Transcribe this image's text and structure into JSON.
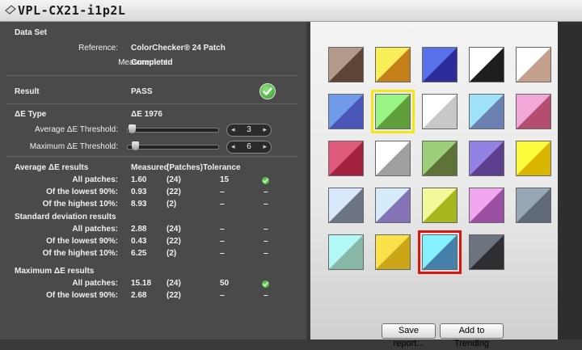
{
  "window": {
    "title": "VPL-CX21-i1p2L"
  },
  "data_set": {
    "heading": "Data Set",
    "reference_label": "Reference:",
    "reference_value": "ColorChecker® 24 Patch",
    "measurement_label": "Measurement:",
    "measurement_value": "Completed"
  },
  "result": {
    "label": "Result",
    "value": "PASS"
  },
  "delta_e": {
    "type_label": "ΔE Type",
    "type_value": "ΔE 1976",
    "average_threshold_label": "Average  ΔE Threshold:",
    "average_threshold_value": "3",
    "average_threshold_fraction": 0.02,
    "maximum_threshold_label": "Maximum ΔE Threshold:",
    "maximum_threshold_value": "6",
    "maximum_threshold_fraction": 0.05
  },
  "avg_results": {
    "heading": "Average ΔE results",
    "col_measured": "Measured",
    "col_patches": "(Patches)",
    "col_tolerance": "Tolerance",
    "rows": [
      {
        "label": "All patches:",
        "measured": "1.60",
        "patches": "(24)",
        "tolerance": "15",
        "status": "check"
      },
      {
        "label": "Of the lowest 90%:",
        "measured": "0.93",
        "patches": "(22)",
        "tolerance": "–",
        "status": "–"
      },
      {
        "label": "Of the highest 10%:",
        "measured": "8.93",
        "patches": "(2)",
        "tolerance": "–",
        "status": "–"
      }
    ]
  },
  "std_results": {
    "heading": "Standard deviation results",
    "rows": [
      {
        "label": "All patches:",
        "measured": "2.88",
        "patches": "(24)",
        "tolerance": "–",
        "status": "–"
      },
      {
        "label": "Of the lowest 90%:",
        "measured": "0.43",
        "patches": "(22)",
        "tolerance": "–",
        "status": "–"
      },
      {
        "label": "Of the highest 10%:",
        "measured": "6.25",
        "patches": "(2)",
        "tolerance": "–",
        "status": "–"
      }
    ]
  },
  "max_results": {
    "heading": "Maximum ΔE results",
    "rows": [
      {
        "label": "All patches:",
        "measured": "15.18",
        "patches": "(24)",
        "tolerance": "50",
        "status": "check"
      },
      {
        "label": "Of the lowest 90%:",
        "measured": "2.68",
        "patches": "(22)",
        "tolerance": "–",
        "status": "–"
      }
    ]
  },
  "patches": [
    {
      "ref": "#b39a8c",
      "meas": "#5d4435"
    },
    {
      "ref": "#f8ee57",
      "meas": "#c57f18"
    },
    {
      "ref": "#5870e8",
      "meas": "#2a2c99"
    },
    {
      "ref": "#ffffff",
      "meas": "#1e1e1e"
    },
    {
      "ref": "#ffffff",
      "meas": "#c3a08c"
    },
    {
      "ref": "#6f9be8",
      "meas": "#4a55b8"
    },
    {
      "ref": "#98f583",
      "meas": "#5e9f3a",
      "highlight": "#f2e613"
    },
    {
      "ref": "#ffffff",
      "meas": "#c8c8c8"
    },
    {
      "ref": "#a0e2f8",
      "meas": "#6980b0"
    },
    {
      "ref": "#f1a7d7",
      "meas": "#b44e71"
    },
    {
      "ref": "#e05a7b",
      "meas": "#a2213e"
    },
    {
      "ref": "#ffffff",
      "meas": "#a0a0a0"
    },
    {
      "ref": "#9bcf79",
      "meas": "#5f7338"
    },
    {
      "ref": "#9382e3",
      "meas": "#5d3f8f"
    },
    {
      "ref": "#fbfb3c",
      "meas": "#d8b600"
    },
    {
      "ref": "#d9e8fc",
      "meas": "#6d7582"
    },
    {
      "ref": "#d7ecfb",
      "meas": "#8474b5"
    },
    {
      "ref": "#f2f99a",
      "meas": "#a5b61c"
    },
    {
      "ref": "#f0a7f0",
      "meas": "#9a4fa2"
    },
    {
      "ref": "#97a7b5",
      "meas": "#5e6a77"
    },
    {
      "ref": "#b2f8f6",
      "meas": "#88b8a8"
    },
    {
      "ref": "#fce24a",
      "meas": "#caa516"
    },
    {
      "ref": "#85f1fc",
      "meas": "#4581a8",
      "highlight": "#d8160f"
    },
    {
      "ref": "#6c7480",
      "meas": "#2e2f33"
    }
  ],
  "buttons": {
    "save_report": "Save report...",
    "add_trending": "Add to Trending"
  },
  "colors": {
    "pass": "#3aa634",
    "selected_yellow": "#f2e613",
    "selected_red": "#d8160f"
  }
}
